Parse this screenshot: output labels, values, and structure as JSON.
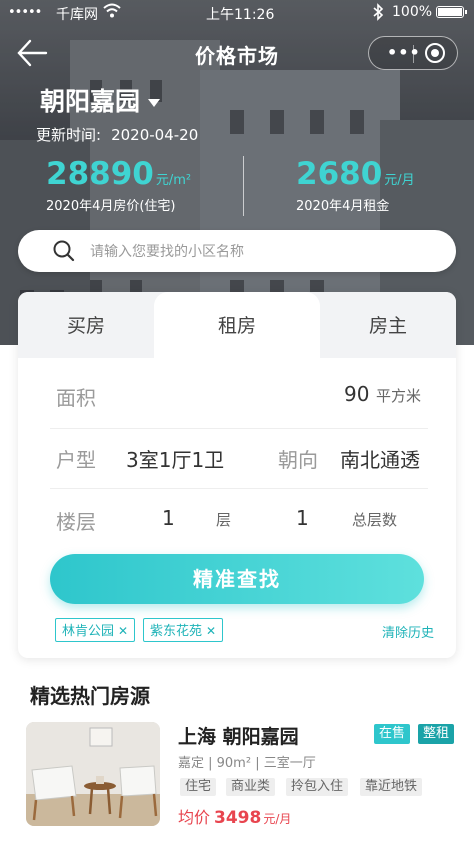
{
  "status_bar": {
    "signal": "•••••",
    "carrier": "千库网",
    "time": "上午11:26",
    "battery": "100%"
  },
  "nav": {
    "title": "价格市场"
  },
  "hero": {
    "community": "朝阳嘉园",
    "update_label": "更新时间:",
    "update_date": "2020-04-20",
    "metrics": [
      {
        "value": "28890",
        "unit": "元/m²",
        "label": "2020年4月房价(住宅)"
      },
      {
        "value": "2680",
        "unit": "元/月",
        "label": "2020年4月租金"
      }
    ]
  },
  "search": {
    "placeholder": "请输入您要找的小区名称"
  },
  "tabs": [
    "买房",
    "租房",
    "房主"
  ],
  "active_tab": "租房",
  "form": {
    "area_label": "面积",
    "area_value": "90",
    "area_unit": "平方米",
    "layout_label": "户型",
    "layout_value": "3室1厅1卫",
    "orientation_label": "朝向",
    "orientation_value": "南北通透",
    "floor_label": "楼层",
    "floor_value": "1",
    "floor_unit": "层",
    "total_floor_value": "1",
    "total_floor_label": "总层数"
  },
  "cta_label": "精准查找",
  "history": {
    "chips": [
      "林肯公园",
      "紫东花苑"
    ],
    "clear_label": "清除历史"
  },
  "section_title": "精选热门房源",
  "listing": {
    "title": "上海 朝阳嘉园",
    "badges": [
      "在售",
      "整租"
    ],
    "meta": "嘉定 | 90m² | 三室一厅",
    "tags": [
      "住宅",
      "商业类",
      "拎包入住",
      "靠近地铁"
    ],
    "price_label": "均价",
    "price_value": "3498",
    "price_unit": "元/月"
  },
  "colors": {
    "accent": "#2ec6cc",
    "accent_dark": "#1aa3a8",
    "price": "#e8454f"
  }
}
